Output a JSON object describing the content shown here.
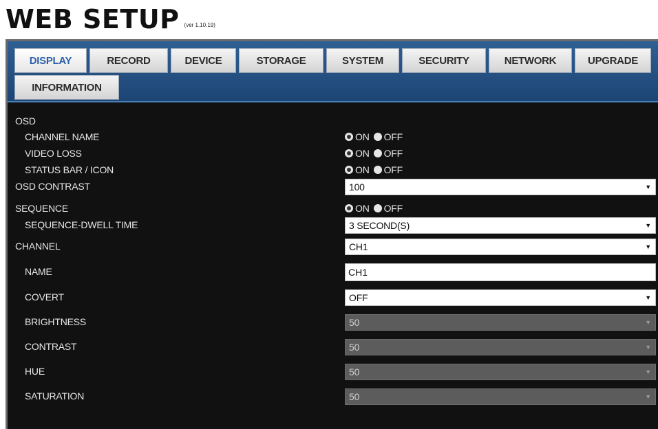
{
  "header": {
    "title": "WEB SETUP",
    "version": "(ver 1.10.19)"
  },
  "tabs": [
    {
      "label": "DISPLAY"
    },
    {
      "label": "RECORD"
    },
    {
      "label": "DEVICE"
    },
    {
      "label": "STORAGE"
    },
    {
      "label": "SYSTEM"
    },
    {
      "label": "SECURITY"
    },
    {
      "label": "NETWORK"
    },
    {
      "label": "UPGRADE"
    },
    {
      "label": "INFORMATION"
    }
  ],
  "active_tab": "DISPLAY",
  "radio_labels": {
    "on": "ON",
    "off": "OFF"
  },
  "display": {
    "osd": {
      "label": "OSD"
    },
    "channel_name": {
      "label": "CHANNEL NAME",
      "selected": "ON"
    },
    "video_loss": {
      "label": "VIDEO LOSS",
      "selected": "ON"
    },
    "status_bar": {
      "label": "STATUS BAR / ICON",
      "selected": "ON"
    },
    "osd_contrast": {
      "label": "OSD CONTRAST",
      "value": "100"
    },
    "sequence": {
      "label": "SEQUENCE",
      "selected": "ON"
    },
    "dwell_time": {
      "label": "SEQUENCE-DWELL TIME",
      "value": "3 SECOND(S)"
    },
    "channel": {
      "label": "CHANNEL",
      "value": "CH1"
    },
    "name": {
      "label": "NAME",
      "value": "CH1"
    },
    "covert": {
      "label": "COVERT",
      "value": "OFF"
    },
    "brightness": {
      "label": "BRIGHTNESS",
      "value": "50"
    },
    "contrast": {
      "label": "CONTRAST",
      "value": "50"
    },
    "hue": {
      "label": "HUE",
      "value": "50"
    },
    "saturation": {
      "label": "SATURATION",
      "value": "50"
    }
  },
  "icons": {
    "dropdown_arrow": "▼"
  },
  "colors": {
    "tab_bar": "#1f4a7a",
    "active_tab_text": "#2e62a8",
    "panel_bg": "#111111"
  }
}
